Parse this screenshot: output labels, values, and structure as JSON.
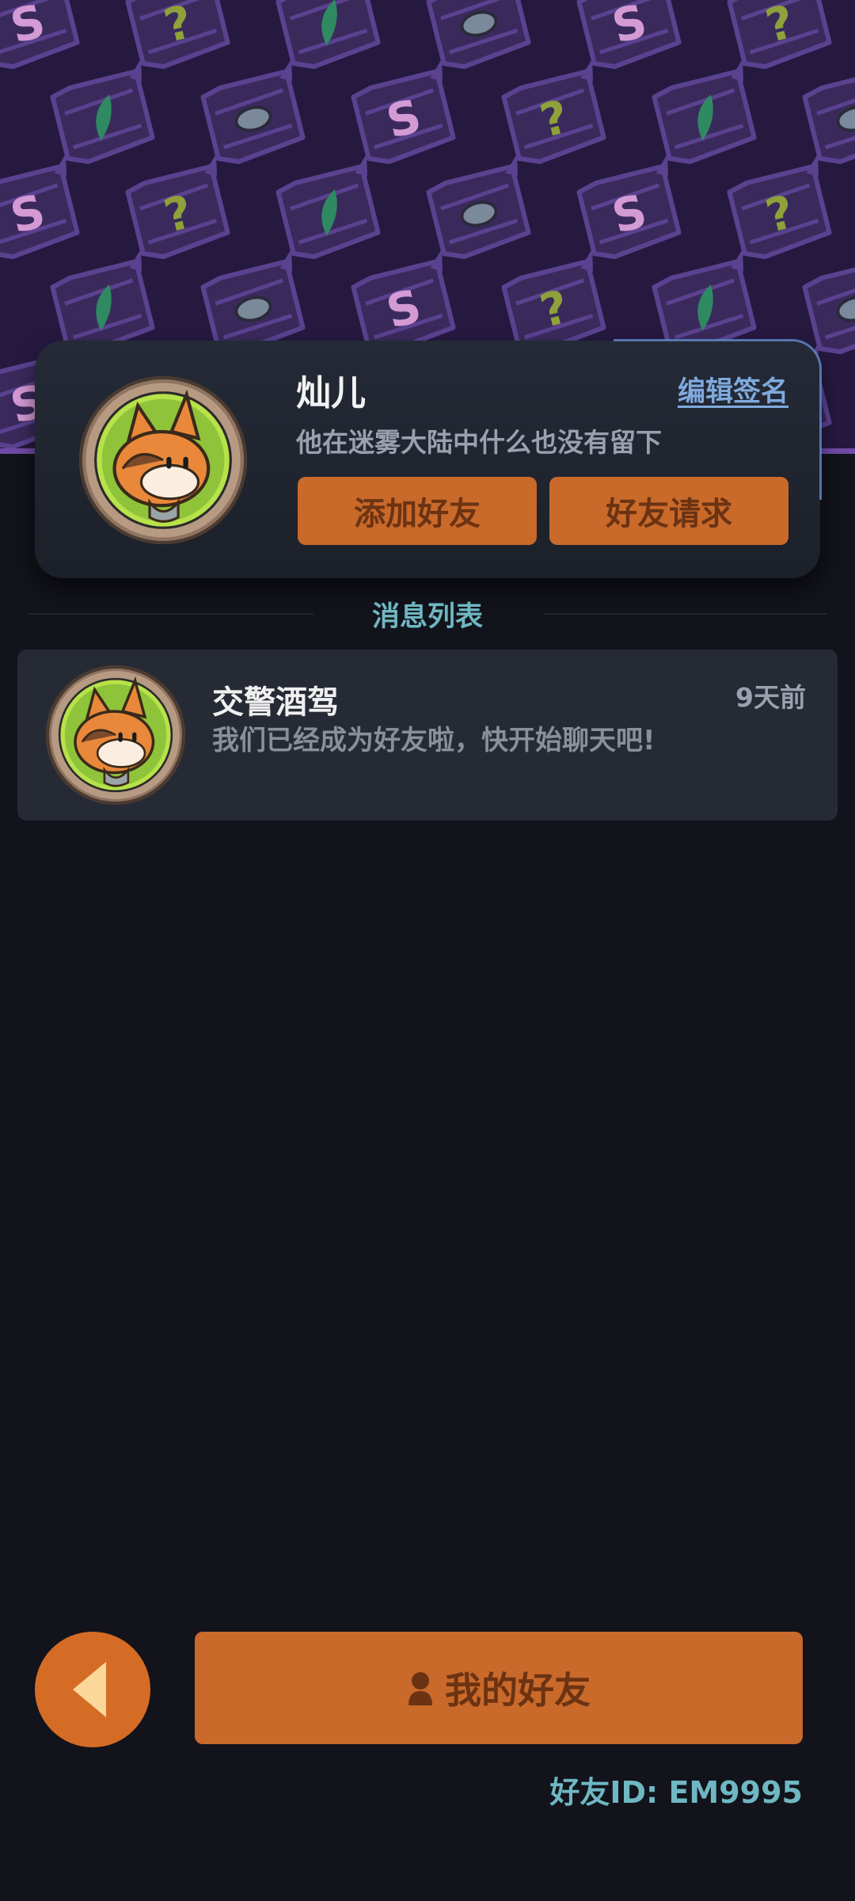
{
  "profile": {
    "name": "灿儿",
    "edit_signature": "编辑签名",
    "signature": "他在迷雾大陆中什么也没有留下",
    "add_friend": "添加好友",
    "friend_requests": "好友请求"
  },
  "messages": {
    "title": "消息列表",
    "items": [
      {
        "name": "交警酒驾",
        "time": "9天前",
        "text": "我们已经成为好友啦，快开始聊天吧!"
      }
    ]
  },
  "bottom": {
    "my_friends": "我的好友",
    "friend_id": "好友ID: EM9995"
  },
  "icons": {
    "back": "back-arrow-icon",
    "person": "person-icon",
    "avatar": "fox-avatar-icon"
  },
  "colors": {
    "accent": "#c9692a",
    "teal_text": "#6fb7c2",
    "banner": "#25193f"
  }
}
